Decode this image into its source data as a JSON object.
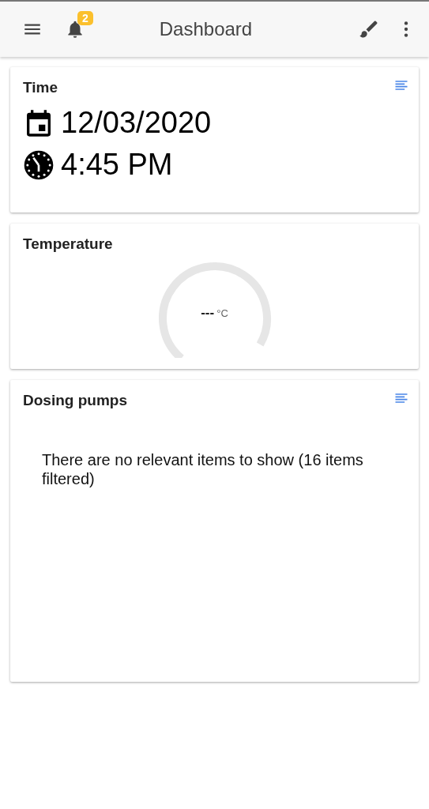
{
  "header": {
    "title": "Dashboard",
    "notification_count": "2"
  },
  "cards": [
    {
      "kind": "time",
      "title": "Time",
      "has_menu": true,
      "date": "12/03/2020",
      "time": "4:45 PM"
    },
    {
      "kind": "gauge",
      "title": "Temperature",
      "has_menu": false,
      "reading": "---",
      "unit": "°C"
    },
    {
      "kind": "list",
      "title": "Dosing pumps",
      "has_menu": true,
      "message": "There are no relevant items to show (16 items filtered)"
    }
  ]
}
